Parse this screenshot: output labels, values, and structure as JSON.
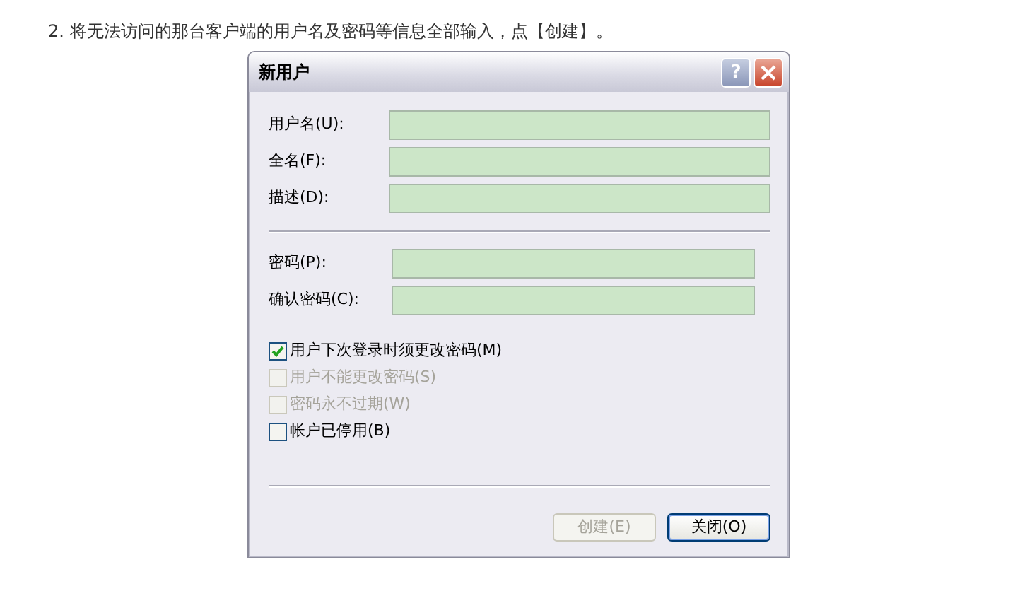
{
  "instruction": "2. 将无法访问的那台客户端的用户名及密码等信息全部输入，点【创建】。",
  "dialog": {
    "title": "新用户",
    "help_button": "?",
    "identity_fields": [
      {
        "label": "用户名(U):"
      },
      {
        "label": "全名(F):"
      },
      {
        "label": "描述(D):"
      }
    ],
    "password_fields": [
      {
        "label": "密码(P):"
      },
      {
        "label": "确认密码(C):"
      }
    ],
    "options": [
      {
        "label": "用户下次登录时须更改密码(M)",
        "checked": true,
        "disabled": false
      },
      {
        "label": "用户不能更改密码(S)",
        "checked": false,
        "disabled": true
      },
      {
        "label": "密码永不过期(W)",
        "checked": false,
        "disabled": true
      },
      {
        "label": "帐户已停用(B)",
        "checked": false,
        "disabled": false
      }
    ],
    "buttons": [
      {
        "label": "创建(E)",
        "disabled": true,
        "default": false
      },
      {
        "label": "关闭(O)",
        "disabled": false,
        "default": true
      }
    ]
  }
}
